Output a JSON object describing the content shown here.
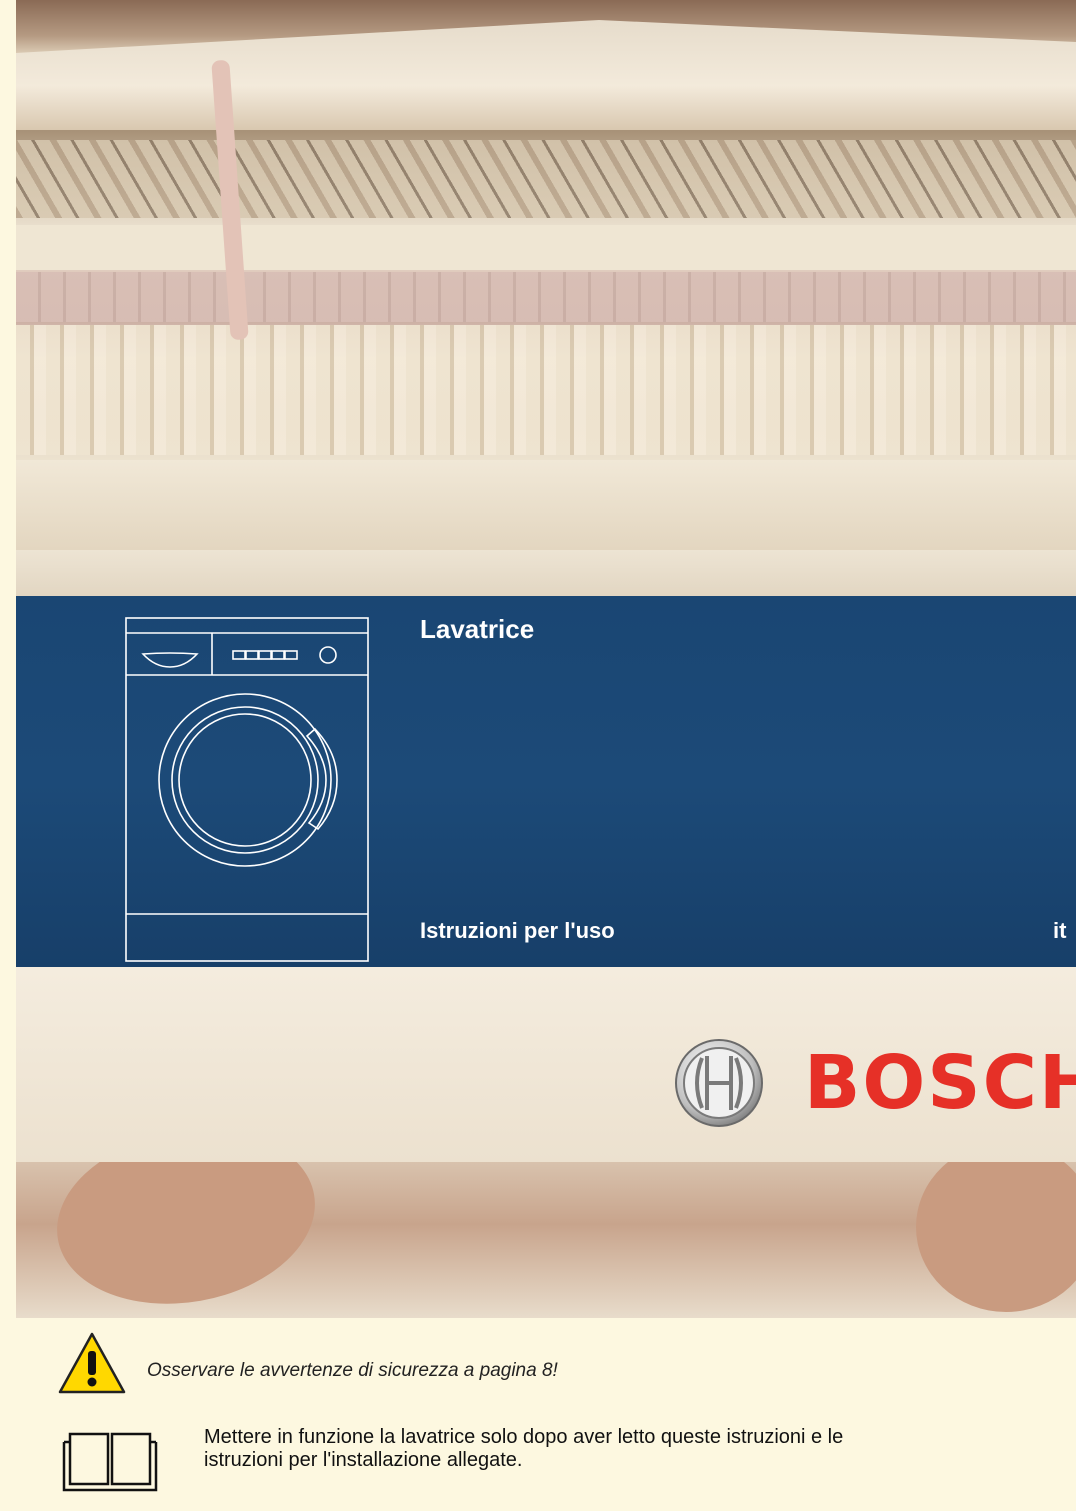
{
  "cover": {
    "title": "Lavatrice",
    "subtitle": "Istruzioni per l'uso",
    "language_code": "it",
    "brand": "BOSCH"
  },
  "notices": {
    "warning": "Osservare le avvertenze di sicurezza a pagina 8!",
    "read_first_line1": "Mettere in funzione la lavatrice solo dopo aver letto queste istruzioni e le",
    "read_first_line2": "istruzioni per l'installazione allegate."
  },
  "colors": {
    "panel_blue": "#1a4673",
    "brand_red": "#e63027",
    "page_background": "#fdf8e0",
    "warning_yellow": "#ffd800"
  },
  "icons": [
    "washing-machine-icon",
    "bosch-logo-icon",
    "warning-icon",
    "book-icon"
  ]
}
